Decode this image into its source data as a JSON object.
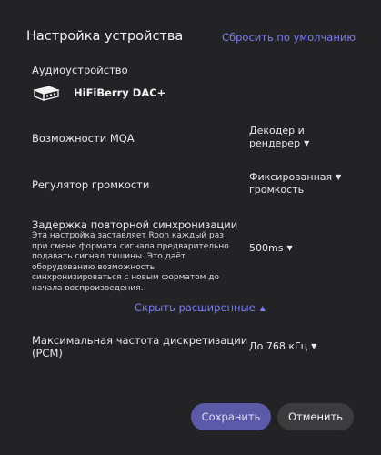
{
  "header": {
    "title": "Настройка устройства",
    "reset_label": "Сбросить по умолчанию"
  },
  "device": {
    "section_label": "Аудиоустройство",
    "name": "HiFiBerry DAC+",
    "icon": "dac-icon"
  },
  "settings": {
    "mqa": {
      "label": "Возможности MQA",
      "value_line1": "Декодер и",
      "value_line2": "рендерер"
    },
    "volume": {
      "label": "Регулятор громкости",
      "value_line1": "Фиксированная",
      "value_line2": "громкость"
    },
    "resync": {
      "label": "Задержка повторной синхронизации",
      "description": "Эта настройка заставляет Roon каждый раз при смене формата сигнала предварительно подавать сигнал тишины. Это даёт оборудованию возможность синхронизироваться с новым форматом до начала воспроизведения.",
      "value": "500ms"
    },
    "max_rate": {
      "label_line1": "Максимальная частота дискретизации",
      "label_line2": "(PCM)",
      "value": "До 768 кГц"
    }
  },
  "advanced_toggle": {
    "label": "Скрыть расширенные"
  },
  "footer": {
    "save_label": "Сохранить",
    "cancel_label": "Отменить"
  },
  "colors": {
    "background": "#232325",
    "accent": "#7b7cf6",
    "save_button": "#5b5aa8",
    "cancel_button": "#3c3c3e"
  }
}
